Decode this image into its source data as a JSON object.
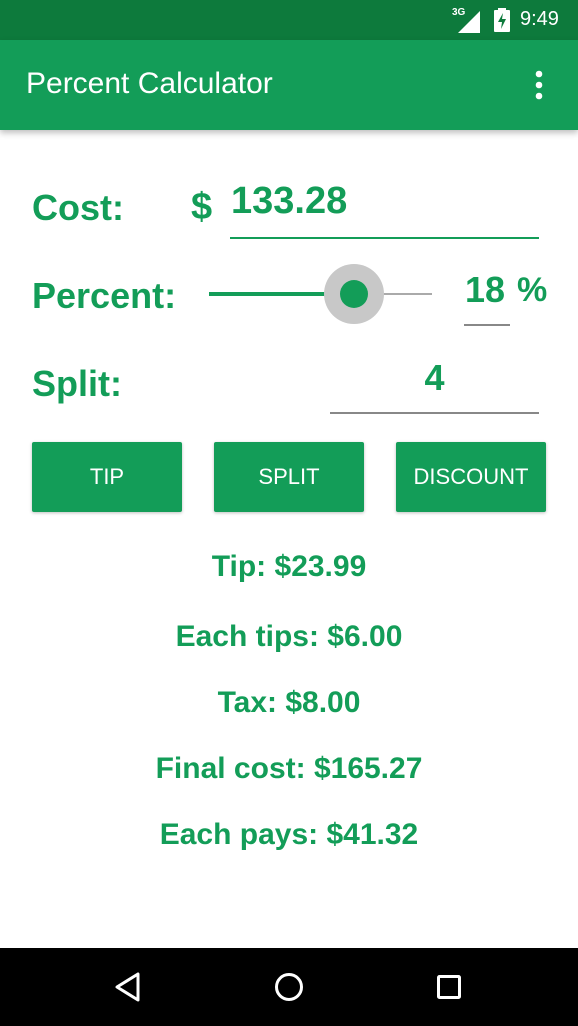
{
  "status_bar": {
    "network_label": "3G",
    "time": "9:49",
    "icons": [
      "signal-icon",
      "battery-charging-icon"
    ]
  },
  "app_bar": {
    "title": "Percent Calculator",
    "menu_icon": "overflow-menu-icon"
  },
  "cost": {
    "label": "Cost:",
    "currency": "$",
    "value": "133.28"
  },
  "percent": {
    "label": "Percent:",
    "value": "18",
    "unit": "%",
    "slider_level": 0.65
  },
  "split": {
    "label": "Split:",
    "value": "4"
  },
  "buttons": {
    "tip": "TIP",
    "split": "SPLIT",
    "discount": "DISCOUNT"
  },
  "results": {
    "tip": "Tip: $23.99",
    "each_tips": "Each tips: $6.00",
    "tax": "Tax: $8.00",
    "final_cost": "Final cost: $165.27",
    "each_pays": "Each pays: $41.32"
  },
  "nav_bar": {
    "icons": [
      "back-icon",
      "home-icon",
      "recents-icon"
    ]
  },
  "colors": {
    "primary": "#139d58",
    "primary_dark": "#0d7a3c",
    "text_on_primary": "#ffffff",
    "nav_bar": "#000000"
  }
}
